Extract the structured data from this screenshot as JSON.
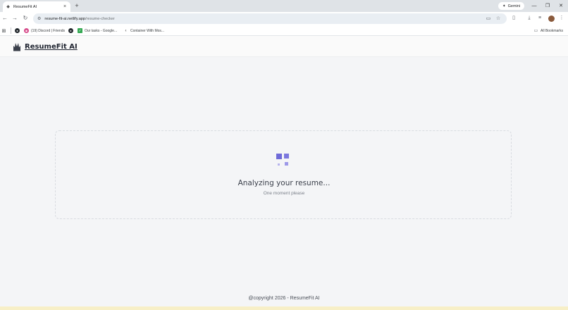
{
  "browser": {
    "tab": {
      "title": "ResumeFit AI",
      "close": "×"
    },
    "new_tab": "+",
    "gemini": {
      "label": "Gemini",
      "icon": "sparkle-icon"
    },
    "window": {
      "minimize": "—",
      "restore": "❐",
      "close": "✕"
    },
    "nav": {
      "back": "←",
      "forward": "→",
      "reload": "↻"
    },
    "url": {
      "host": "resume-fit-ai.netlify.app",
      "path": "/resume-checker"
    },
    "bookmarks": [
      {
        "label": "(19) Discord | Friends",
        "icon": "discord-icon"
      },
      {
        "label": "Our tasks - Google...",
        "icon": "google-tasks-icon"
      },
      {
        "label": "Container With Mos...",
        "icon": "leetcode-icon"
      }
    ],
    "all_bookmarks": "All Bookmarks"
  },
  "site": {
    "brand": "ResumeFit AI"
  },
  "status": {
    "title": "Analyzing your resume...",
    "subtitle": "One moment please"
  },
  "footer": {
    "text": "@copyright 2026 - ResumeFit AI"
  },
  "colors": {
    "accent": "#6f6bd8",
    "page_bg": "#f4f5f7"
  }
}
